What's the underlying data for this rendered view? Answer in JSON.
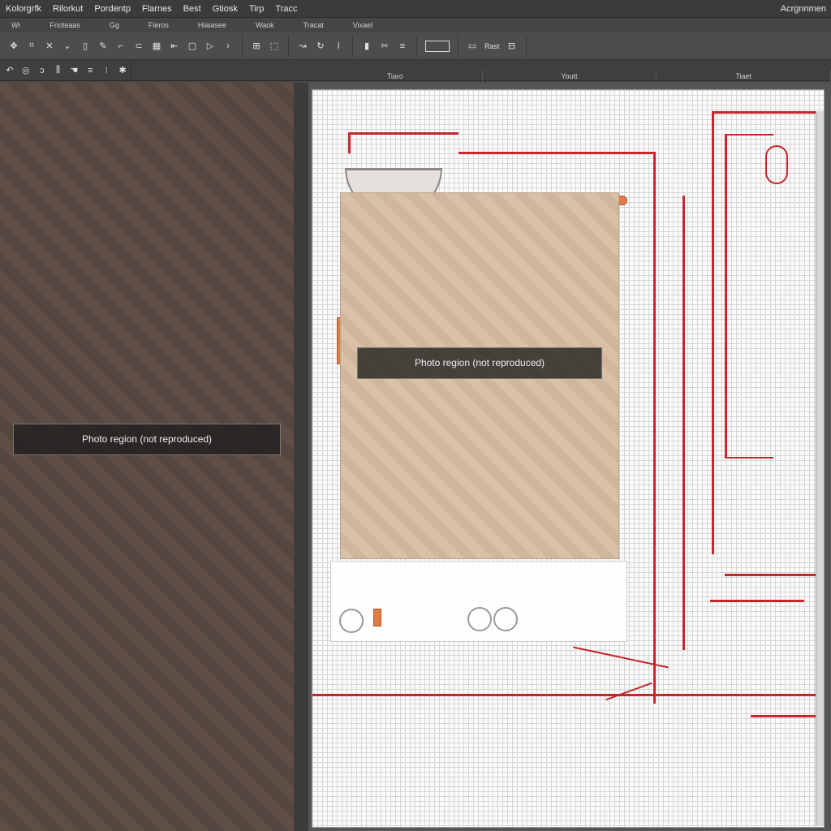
{
  "menubar": {
    "items": [
      "Kolorgrfk",
      "Rilorkut",
      "Pordentp",
      "Flarnes",
      "Best",
      "Gtiosk",
      "Tirp",
      "Tracc"
    ],
    "right": "Acrgnnmen"
  },
  "options_bar": {
    "items": [
      "Wr",
      "Frioteaas",
      "Gg",
      "Fieros",
      "Hiaiasee",
      "Waok",
      "Tracat",
      "Vixael"
    ]
  },
  "toolbar": {
    "label_right": "Rast",
    "icons": [
      "move-icon",
      "crop-icon",
      "cross-icon",
      "chevron-down-icon",
      "frame-icon",
      "pen-icon",
      "brush-icon",
      "link-icon",
      "grid-icon",
      "arrow-left-icon",
      "square-icon",
      "play-icon",
      "chevron-right-icon",
      "layout-icon",
      "select-icon",
      "curve-icon",
      "align-icon",
      "stack-icon"
    ]
  },
  "tabs": [
    "Tiaro",
    "Youtt",
    "Tiaet"
  ],
  "photo_panel": {
    "note": "Photo region (not reproduced)"
  },
  "canvas": {
    "photo_note": "Photo region (not reproduced)"
  }
}
